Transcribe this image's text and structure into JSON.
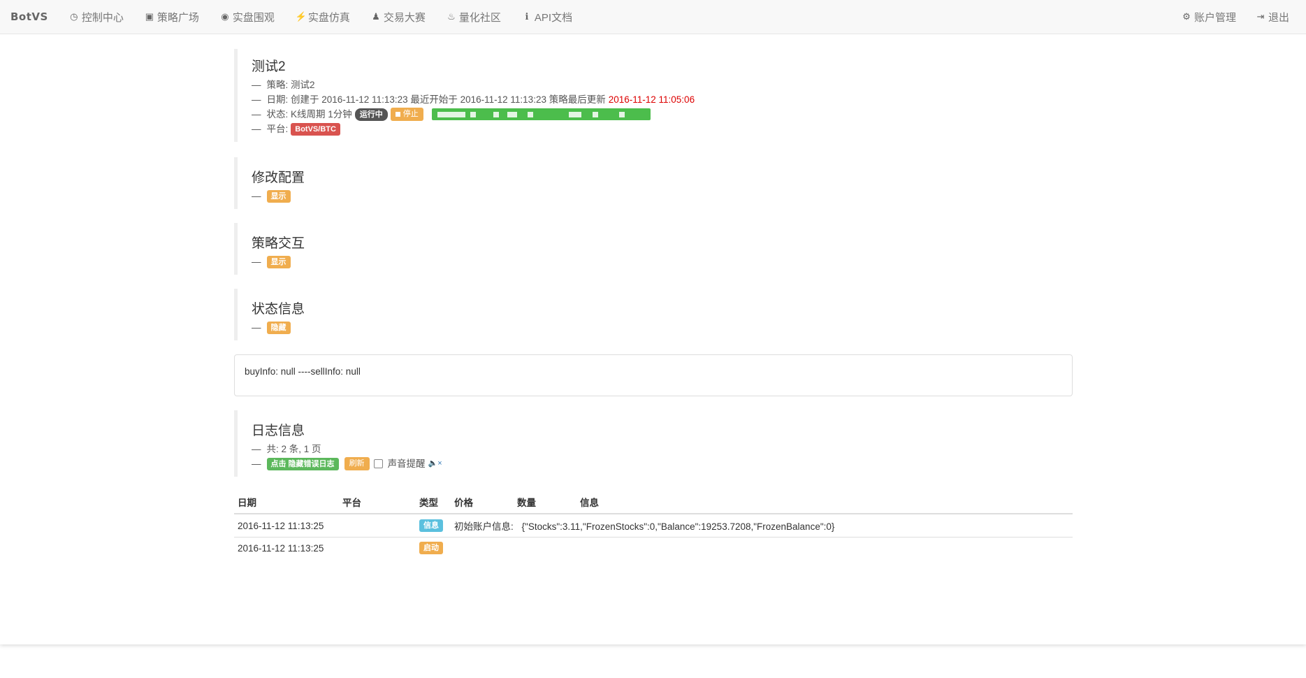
{
  "nav": {
    "brand": "BotVS",
    "items": [
      {
        "label": "控制中心",
        "icon": "dashboard-icon",
        "glyph": "◷"
      },
      {
        "label": "策略广场",
        "icon": "cart-icon",
        "glyph": "🛒"
      },
      {
        "label": "实盘围观",
        "icon": "play-circle-icon",
        "glyph": "◉"
      },
      {
        "label": "实盘仿真",
        "icon": "flash-icon",
        "glyph": "⚡"
      },
      {
        "label": "交易大赛",
        "icon": "chess-pawn-icon",
        "glyph": "♟"
      },
      {
        "label": "量化社区",
        "icon": "fire-icon",
        "glyph": "♨"
      },
      {
        "label": "API文档",
        "icon": "info-icon",
        "glyph": "ℹ"
      }
    ],
    "account": {
      "label": "账户管理",
      "icon": "gear-icon",
      "glyph": "⚙"
    },
    "logout": {
      "label": "退出",
      "icon": "logout-icon",
      "glyph": "⇥"
    }
  },
  "robot": {
    "title": "测试2",
    "strategy_line": "策略: 测试2",
    "date_line": "日期: 创建于 2016-11-12 11:13:23 最近开始于 2016-11-12 11:13:23 策略最后更新",
    "last_update": "2016-11-12 11:05:06",
    "status_prefix": "状态: K线周期 1分钟",
    "status_badge": "运行中",
    "stop_button": "停止",
    "platform_prefix": "平台:",
    "platform_badge": "BotVS/BTC"
  },
  "config": {
    "title": "修改配置",
    "toggle": "显示"
  },
  "interaction": {
    "title": "策略交互",
    "toggle": "显示"
  },
  "status_info": {
    "title": "状态信息",
    "toggle": "隐藏",
    "content": "buyInfo: null ----sellInfo: null"
  },
  "logs": {
    "title": "日志信息",
    "summary": "共: 2 条, 1 页",
    "hide_error_button": "点击 隐藏错误日志",
    "refresh_button": "刷新",
    "sound_label": "声音提醒",
    "columns": [
      "日期",
      "平台",
      "类型",
      "价格",
      "数量",
      "信息"
    ],
    "rows": [
      {
        "date": "2016-11-12 11:13:25",
        "platform": "",
        "type": "信息",
        "type_color": "#5bc0de",
        "price": "初始账户信息:",
        "amount": "",
        "info": "{\"Stocks\":3.11,\"FrozenStocks\":0,\"Balance\":19253.7208,\"FrozenBalance\":0}"
      },
      {
        "date": "2016-11-12 11:13:25",
        "platform": "",
        "type": "启动",
        "type_color": "#f0ad4e",
        "price": "",
        "amount": "",
        "info": ""
      }
    ]
  },
  "colors": {
    "accent_red": "#dd0000",
    "orange": "#f0ad4e",
    "green": "#5cb85c",
    "blue": "#5bc0de",
    "danger": "#d9534f"
  }
}
